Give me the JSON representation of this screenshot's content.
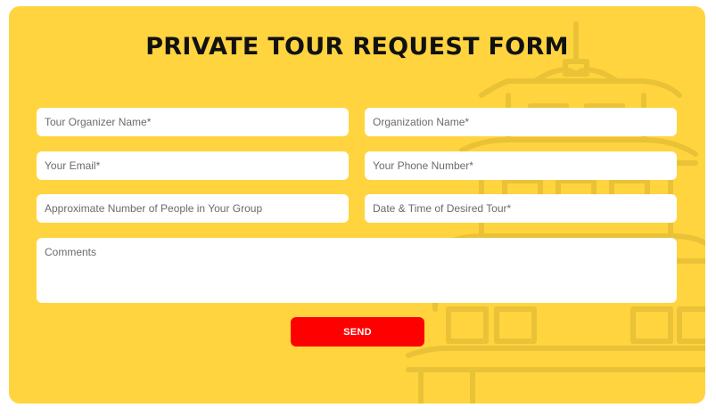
{
  "form": {
    "title": "PRIVATE TOUR REQUEST FORM",
    "fields": {
      "organizer_name": {
        "placeholder": "Tour Organizer Name*",
        "value": ""
      },
      "organization_name": {
        "placeholder": "Organization Name*",
        "value": ""
      },
      "email": {
        "placeholder": "Your Email*",
        "value": ""
      },
      "phone": {
        "placeholder": "Your Phone Number*",
        "value": ""
      },
      "group_size": {
        "placeholder": "Approximate Number of People in Your Group",
        "value": ""
      },
      "desired_datetime": {
        "placeholder": "Date & Time of Desired Tour*",
        "value": ""
      },
      "comments": {
        "placeholder": "Comments",
        "value": ""
      }
    },
    "submit_label": "SEND"
  },
  "colors": {
    "background": "#ffd43f",
    "title": "#111111",
    "button": "#ff0000",
    "button_text": "#ffffff",
    "field_background": "#ffffff"
  },
  "decoration": {
    "background_icon": "pagoda-icon"
  }
}
